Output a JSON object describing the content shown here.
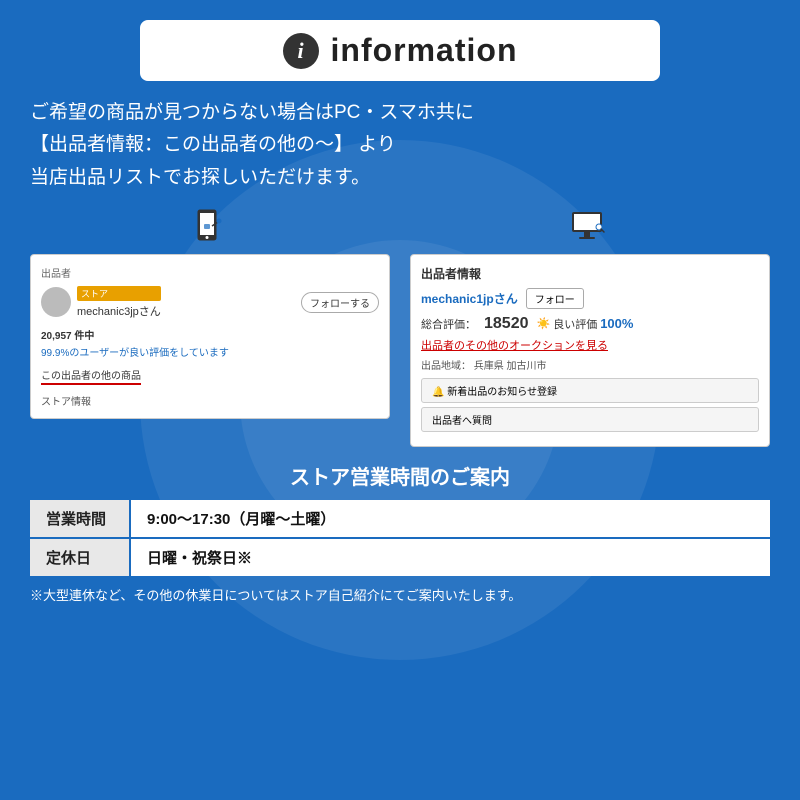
{
  "header": {
    "icon_label": "i",
    "title": "information"
  },
  "main_text": {
    "line1": "ご希望の商品が見つからない場合はPC・スマホ共に",
    "line2": "【出品者情報：この出品者の他の〜】 より",
    "line3": "当店出品リストでお探しいただけます。"
  },
  "left_card": {
    "label": "出品者",
    "store_badge": "ストア",
    "seller_name": "mechanic3jpさん",
    "follow_btn": "フォローする",
    "stats": "20,957 件中",
    "rating": "99.9%のユーザーが良い評価をしています",
    "other_link": "この出品者の他の商品",
    "store_info": "ストア情報"
  },
  "right_card": {
    "header": "出品者情報",
    "seller_name": "mechanic1jpさん",
    "follow_btn": "フォロー",
    "rating_label": "総合評価：",
    "rating_num": "18520",
    "good_label": "良い評価",
    "good_pct": "100%",
    "auction_link": "出品者のその他のオークションを見る",
    "location_label": "出品地域：",
    "location_value": "兵庫県 加古川市",
    "notify_btn": "🔔 新着出品のお知らせ登録",
    "question_btn": "出品者へ質問"
  },
  "business": {
    "title": "ストア営業時間のご案内",
    "rows": [
      {
        "label": "営業時間",
        "value": "9:00〜17:30（月曜〜土曜）"
      },
      {
        "label": "定休日",
        "value": "日曜・祝祭日※"
      }
    ]
  },
  "footer_note": "※大型連休など、その他の休業日についてはストア自己紹介にてご案内いたします。"
}
